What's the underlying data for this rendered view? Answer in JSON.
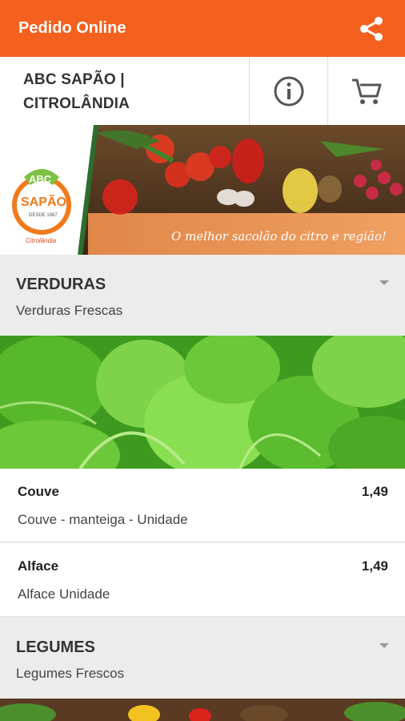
{
  "appbar": {
    "title": "Pedido Online",
    "share_icon": "share-icon"
  },
  "store": {
    "name_line1": "ABC SAPÃO |",
    "name_line2": "CITROLÂNDIA",
    "info_icon": "info-icon",
    "cart_icon": "cart-icon"
  },
  "banner": {
    "logo_top": "ABC",
    "logo_name": "SAPÃO",
    "logo_est": "DESDE 1987",
    "logo_sub": "Citrolândia",
    "slogan": "O melhor sacolão do citro e região!"
  },
  "sections": [
    {
      "title": "VERDURAS",
      "subtitle": "Verduras Frescas",
      "items": [
        {
          "name": "Couve",
          "price": "1,49",
          "description": "Couve - manteiga - Unidade"
        },
        {
          "name": "Alface",
          "price": "1,49",
          "description": "Alface Unidade"
        }
      ]
    },
    {
      "title": "LEGUMES",
      "subtitle": "Legumes Frescos"
    }
  ],
  "colors": {
    "accent": "#f4601e",
    "background": "#ececec"
  }
}
